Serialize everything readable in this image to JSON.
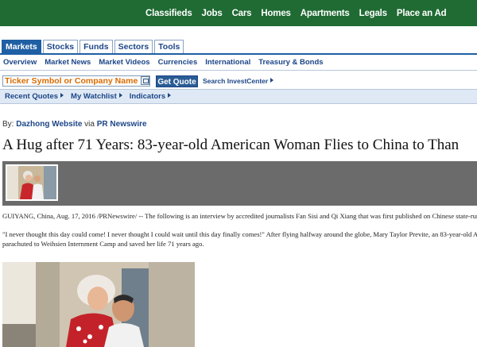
{
  "topnav": {
    "items": [
      "Classifieds",
      "Jobs",
      "Cars",
      "Homes",
      "Apartments",
      "Legals",
      "Place an Ad"
    ]
  },
  "tabs": [
    "Markets",
    "Stocks",
    "Funds",
    "Sectors",
    "Tools"
  ],
  "subnav": [
    "Overview",
    "Market News",
    "Market Videos",
    "Currencies",
    "International",
    "Treasury & Bonds"
  ],
  "quote": {
    "placeholder": "Ticker Symbol or Company Name",
    "button": "Get Quote",
    "search_link": "Search InvestCenter"
  },
  "quick_links": [
    "Recent Quotes",
    "My Watchlist",
    "Indicators"
  ],
  "article": {
    "by_prefix": "By:",
    "author": "Dazhong Website",
    "via": "via",
    "source": "PR Newswire",
    "headline": "A Hug after 71 Years: 83-year-old American Woman Flies to China to Than",
    "p1": "GUIYANG, China, Aug. 17, 2016 /PRNewswire/ -- The following is an interview by accredited journalists Fan Sisi and Qi Xiang that was first published on Chinese state-run",
    "p2a": "\"I never thought this day could come! I never thought I could wait until this day finally comes!\" After flying halfway around the globe, Mary Taylor Previte, an 83-year-old A",
    "p2b": "parachuted to Weihsien Internment Camp and saved her life 71 years ago."
  },
  "colors": {
    "topnav_bg": "#1f6b33",
    "tab_active": "#1f5fa4",
    "link_blue": "#1c4587",
    "ticker_text": "#d96b00",
    "gallery_bg": "#6b6b6b"
  }
}
